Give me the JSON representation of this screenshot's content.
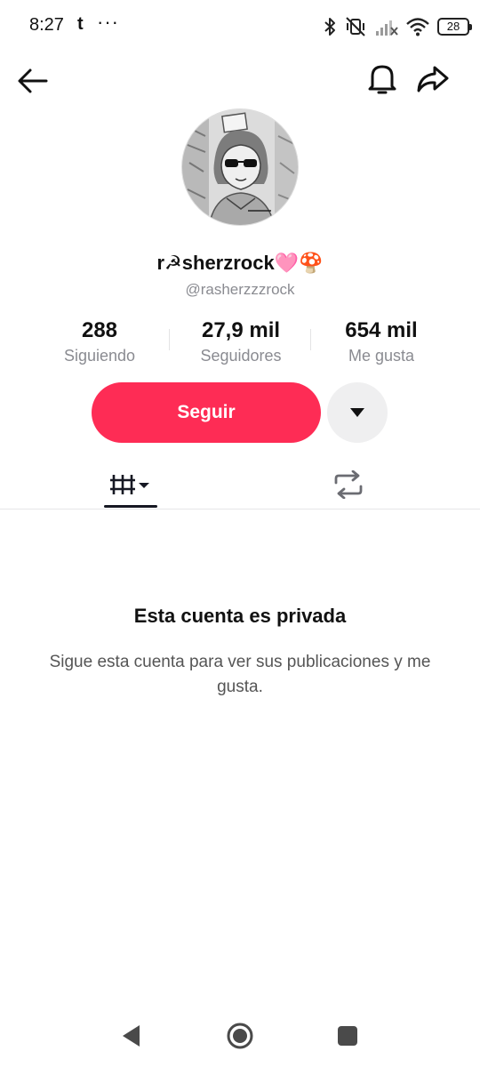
{
  "status_bar": {
    "time": "8:27",
    "notif_app": "t",
    "more": "···",
    "battery": "28",
    "icons": [
      "bluetooth-icon",
      "vibrate-off-icon",
      "signal-off-icon",
      "wifi-icon",
      "battery-icon"
    ]
  },
  "header": {
    "icons": [
      "arrow-left-icon",
      "bell-icon",
      "share-icon"
    ]
  },
  "profile": {
    "display_name": "r☭sherzrock🩷🍄",
    "handle": "@rasherzzzrock"
  },
  "stats": {
    "following_value": "288",
    "following_label": "Siguiendo",
    "followers_value": "27,9 mil",
    "followers_label": "Seguidores",
    "likes_value": "654 mil",
    "likes_label": "Me gusta"
  },
  "actions": {
    "follow_label": "Seguir",
    "follow_color": "#fe2c55"
  },
  "tabs": {
    "icons": [
      "grid-videos-icon",
      "repost-icon"
    ],
    "active": "videos"
  },
  "private": {
    "title": "Esta cuenta es privada",
    "subtitle": "Sigue esta cuenta para ver sus publicaciones y me gusta."
  },
  "nav_bar": {
    "icons": [
      "nav-back-icon",
      "nav-home-icon",
      "nav-recents-icon"
    ]
  }
}
